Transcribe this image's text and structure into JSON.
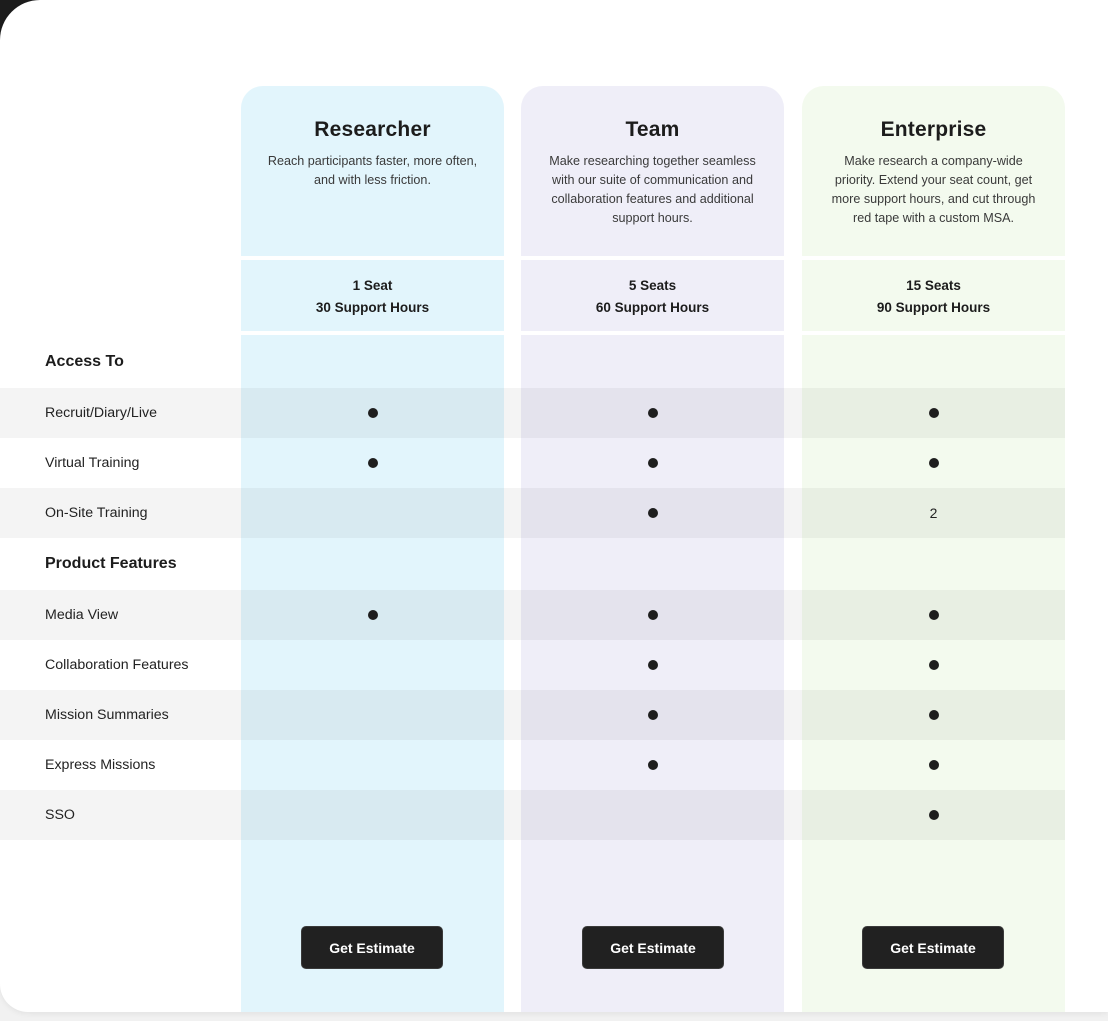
{
  "colors": {
    "researcher_bg": "#e2f5fc",
    "team_bg": "#efeef8",
    "enterprise_bg": "#f3faee",
    "button_bg": "#212121",
    "dot": "#1e1e1e"
  },
  "plans": [
    {
      "name": "Researcher",
      "description": "Reach participants faster, more often, and with less friction.",
      "seats": "1 Seat",
      "support_hours": "30 Support Hours",
      "cta_label": "Get Estimate"
    },
    {
      "name": "Team",
      "description": "Make researching together seamless with our suite of communication and collaboration features and additional support hours.",
      "seats": "5 Seats",
      "support_hours": "60 Support Hours",
      "cta_label": "Get Estimate"
    },
    {
      "name": "Enterprise",
      "description": "Make research a company-wide priority. Extend your seat count, get more support hours, and cut through red tape with a custom MSA.",
      "seats": "15 Seats",
      "support_hours": "90 Support Hours",
      "cta_label": "Get Estimate"
    }
  ],
  "sections": [
    {
      "title": "Access To",
      "rows": [
        {
          "label": "Recruit/Diary/Live",
          "values": [
            "dot",
            "dot",
            "dot"
          ]
        },
        {
          "label": "Virtual Training",
          "values": [
            "dot",
            "dot",
            "dot"
          ]
        },
        {
          "label": "On-Site Training",
          "values": [
            "",
            "dot",
            "2"
          ]
        }
      ]
    },
    {
      "title": "Product Features",
      "rows": [
        {
          "label": "Media View",
          "values": [
            "dot",
            "dot",
            "dot"
          ]
        },
        {
          "label": "Collaboration Features",
          "values": [
            "",
            "dot",
            "dot"
          ]
        },
        {
          "label": "Mission Summaries",
          "values": [
            "",
            "dot",
            "dot"
          ]
        },
        {
          "label": "Express Missions",
          "values": [
            "",
            "dot",
            "dot"
          ]
        },
        {
          "label": "SSO",
          "values": [
            "",
            "",
            "dot"
          ]
        }
      ]
    }
  ]
}
